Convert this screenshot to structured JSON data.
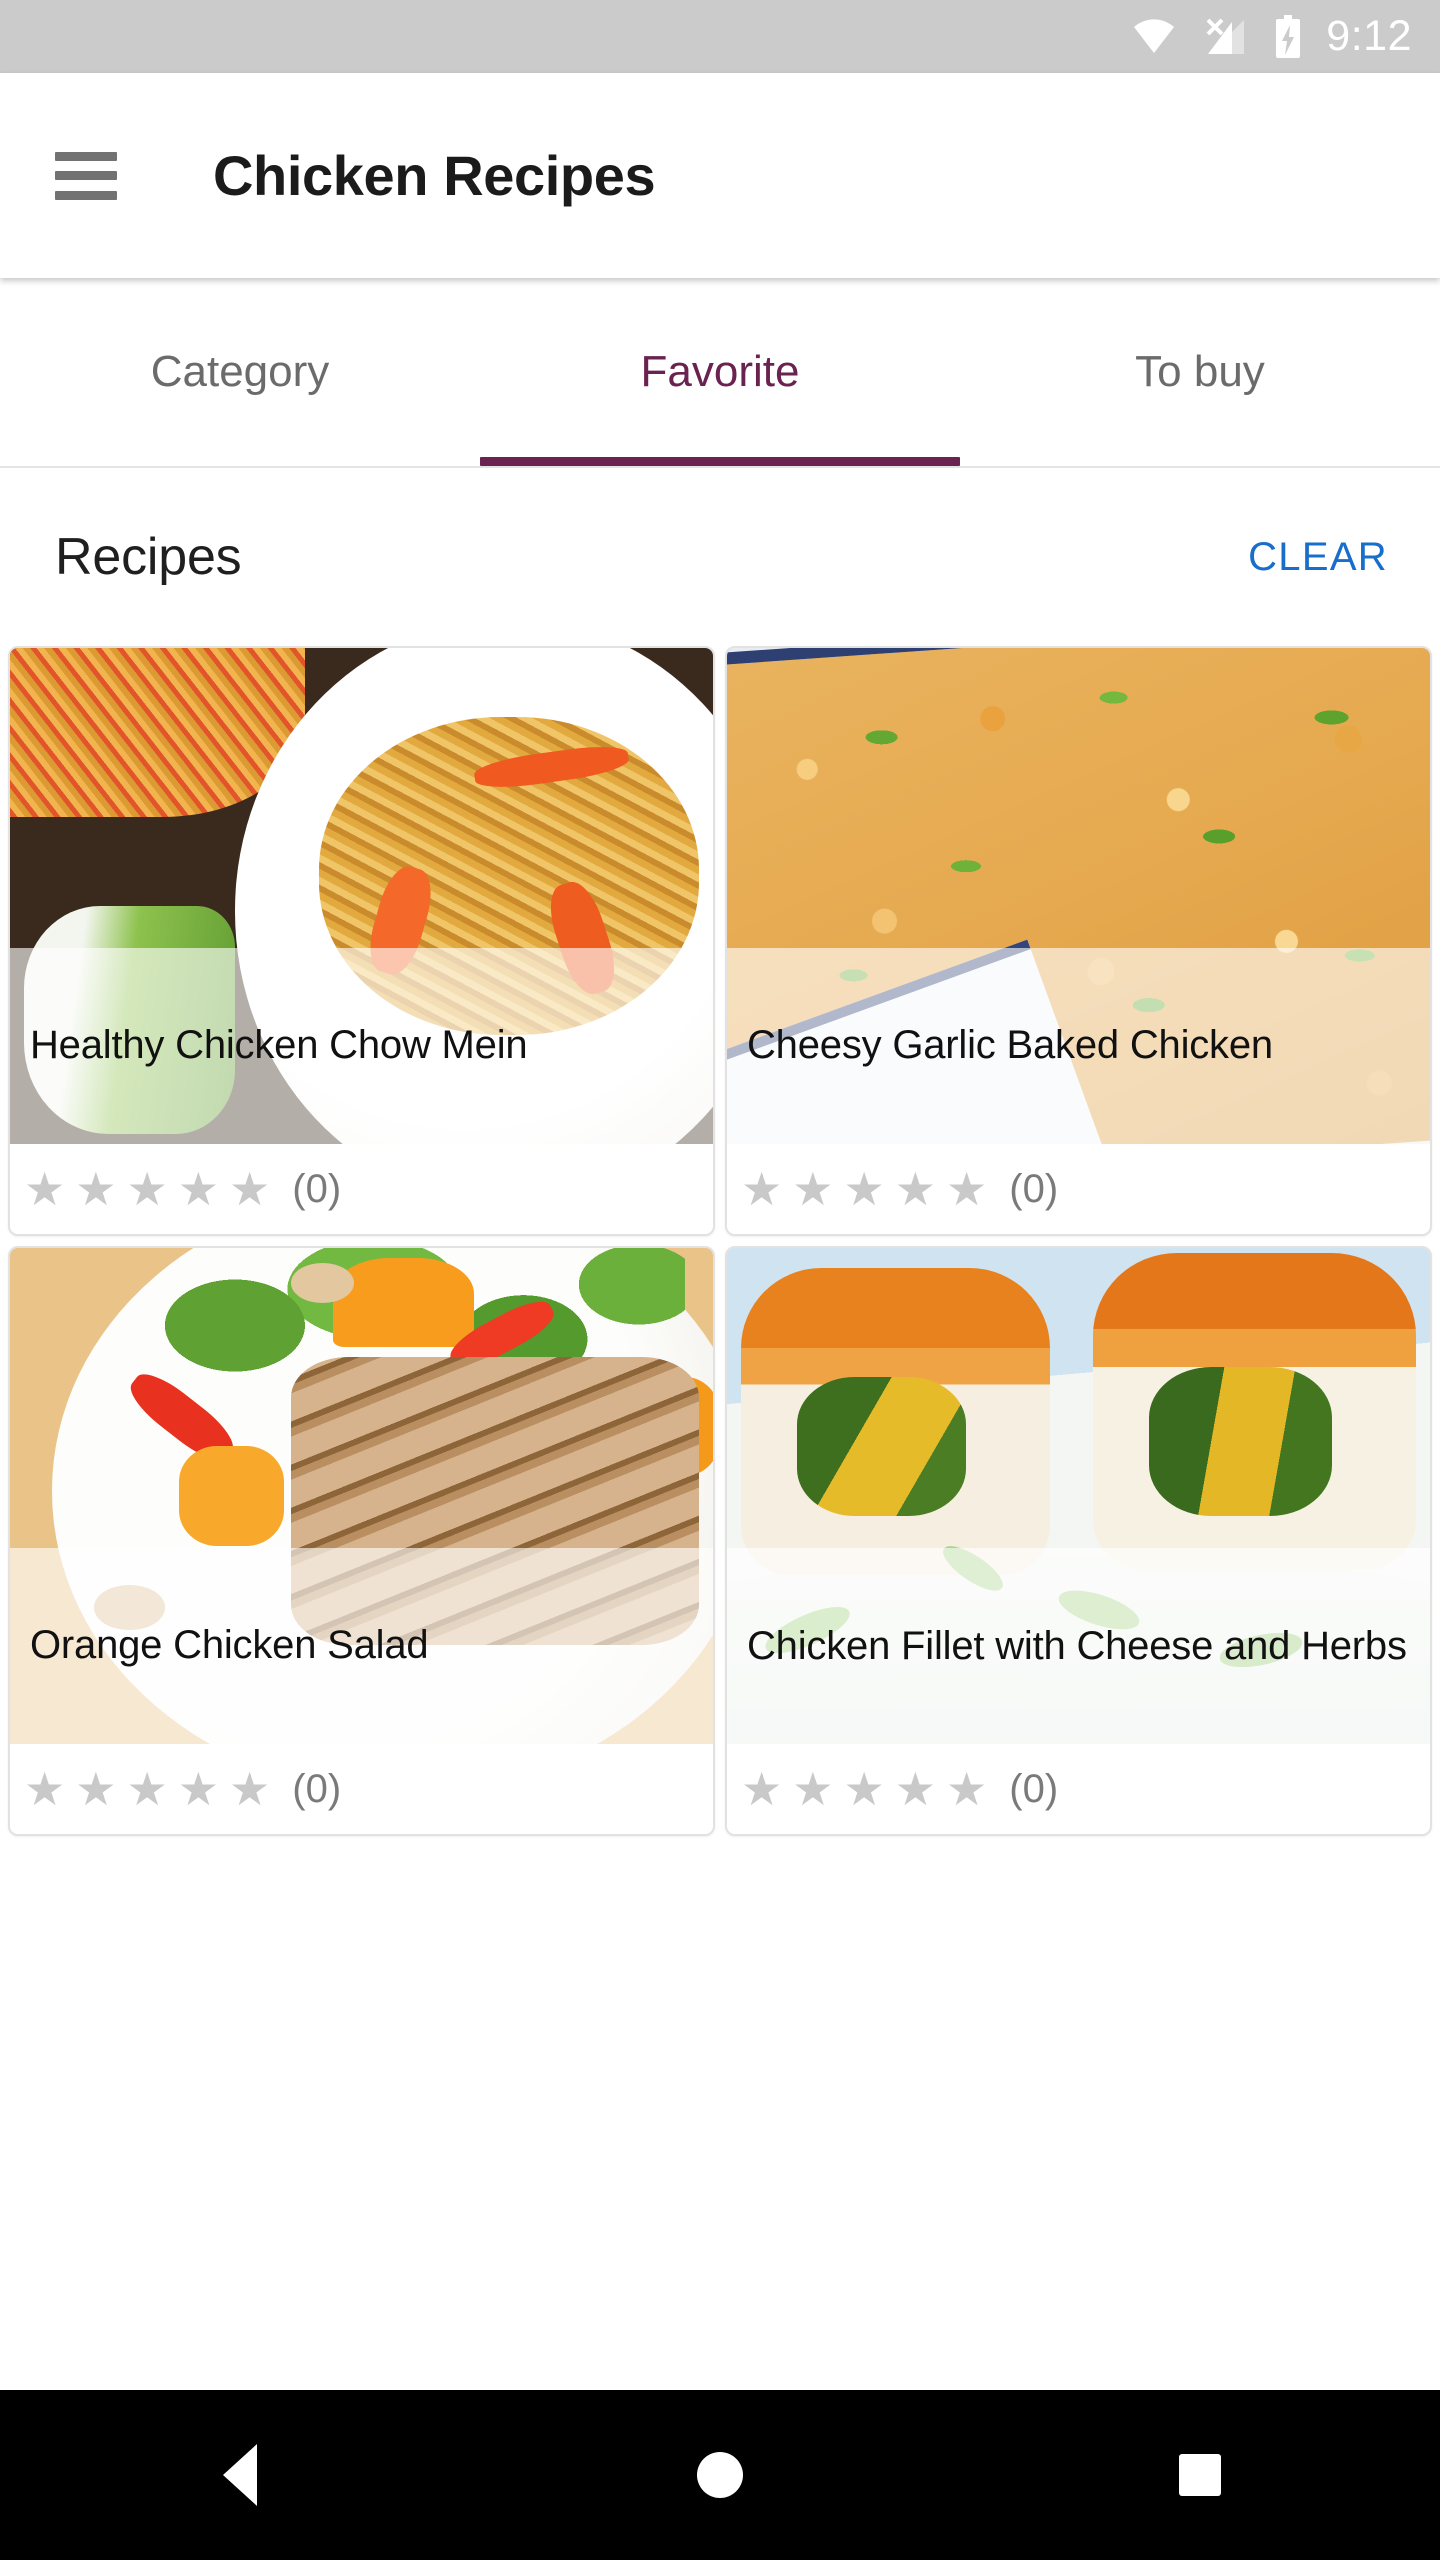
{
  "status_bar": {
    "time": "9:12",
    "icons": [
      "wifi-icon",
      "cellular-no-sim-icon",
      "battery-charging-icon"
    ],
    "background_color": "#cbcbcb"
  },
  "app_bar": {
    "menu_icon": "hamburger-menu-icon",
    "title": "Chicken Recipes"
  },
  "tabs": {
    "items": [
      {
        "label": "Category",
        "active": false
      },
      {
        "label": "Favorite",
        "active": true
      },
      {
        "label": "To buy",
        "active": false
      }
    ],
    "active_color": "#6a2251",
    "inactive_color": "#6b6b6b"
  },
  "section": {
    "title": "Recipes",
    "action_label": "CLEAR",
    "action_color": "#1a6ecb"
  },
  "recipes": [
    {
      "title": "Healthy Chicken Chow Mein",
      "rating": 0,
      "rating_count_label": "(0)",
      "stars": [
        "★",
        "★",
        "★",
        "★",
        "★"
      ]
    },
    {
      "title": "Cheesy Garlic Baked Chicken",
      "rating": 0,
      "rating_count_label": "(0)",
      "stars": [
        "★",
        "★",
        "★",
        "★",
        "★"
      ]
    },
    {
      "title": "Orange Chicken Salad",
      "rating": 0,
      "rating_count_label": "(0)",
      "stars": [
        "★",
        "★",
        "★",
        "★",
        "★"
      ]
    },
    {
      "title": "Chicken Fillet with Cheese and Herbs",
      "rating": 0,
      "rating_count_label": "(0)",
      "stars": [
        "★",
        "★",
        "★",
        "★",
        "★"
      ]
    }
  ],
  "nav_bar": {
    "back_icon": "back-triangle-icon",
    "home_icon": "home-circle-icon",
    "recents_icon": "recents-square-icon",
    "background_color": "#000000"
  }
}
